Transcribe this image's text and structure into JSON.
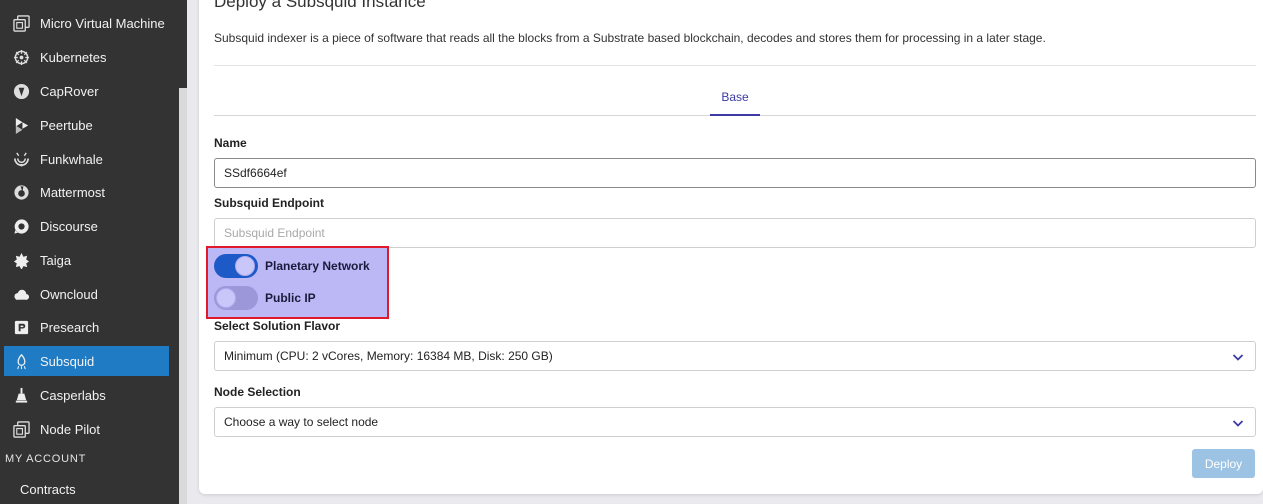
{
  "sidebar": {
    "items": [
      {
        "label": "Micro Virtual Machine",
        "icon": "vm-icon",
        "active": false
      },
      {
        "label": "Kubernetes",
        "icon": "kubernetes-icon",
        "active": false
      },
      {
        "label": "CapRover",
        "icon": "caprover-icon",
        "active": false
      },
      {
        "label": "Peertube",
        "icon": "peertube-icon",
        "active": false
      },
      {
        "label": "Funkwhale",
        "icon": "funkwhale-icon",
        "active": false
      },
      {
        "label": "Mattermost",
        "icon": "mattermost-icon",
        "active": false
      },
      {
        "label": "Discourse",
        "icon": "discourse-icon",
        "active": false
      },
      {
        "label": "Taiga",
        "icon": "taiga-icon",
        "active": false
      },
      {
        "label": "Owncloud",
        "icon": "owncloud-icon",
        "active": false
      },
      {
        "label": "Presearch",
        "icon": "presearch-icon",
        "active": false
      },
      {
        "label": "Subsquid",
        "icon": "subsquid-icon",
        "active": true
      },
      {
        "label": "Casperlabs",
        "icon": "casperlabs-icon",
        "active": false
      },
      {
        "label": "Node Pilot",
        "icon": "nodepilot-icon",
        "active": false
      }
    ],
    "section_title": "MY ACCOUNT",
    "contracts_label": "Contracts"
  },
  "main": {
    "title": "Deploy a Subsquid Instance",
    "description": "Subsquid indexer is a piece of software that reads all the blocks from a Substrate based blockchain, decodes and stores them for processing in a later stage.",
    "tabs": [
      {
        "label": "Base",
        "active": true
      }
    ],
    "name_field": {
      "label": "Name",
      "value": "SSdf6664ef"
    },
    "endpoint_field": {
      "label": "Subsquid Endpoint",
      "value": "",
      "placeholder": "Subsquid Endpoint"
    },
    "toggles": [
      {
        "label": "Planetary Network",
        "on": true
      },
      {
        "label": "Public IP",
        "on": false
      }
    ],
    "flavor": {
      "label": "Select Solution Flavor",
      "value": "Minimum (CPU: 2 vCores, Memory: 16384 MB, Disk: 250 GB)"
    },
    "node_selection": {
      "label": "Node Selection",
      "value": "Choose a way to select node"
    },
    "deploy_label": "Deploy"
  },
  "colors": {
    "sidebar_bg": "#333333",
    "active_item": "#1f7cc4",
    "accent": "#3d3aa6",
    "toggle_on": "#1e59c8",
    "highlight_fill": "#bcb8f6",
    "highlight_border": "#e01a2a",
    "deploy_button": "#9cc3e4"
  }
}
